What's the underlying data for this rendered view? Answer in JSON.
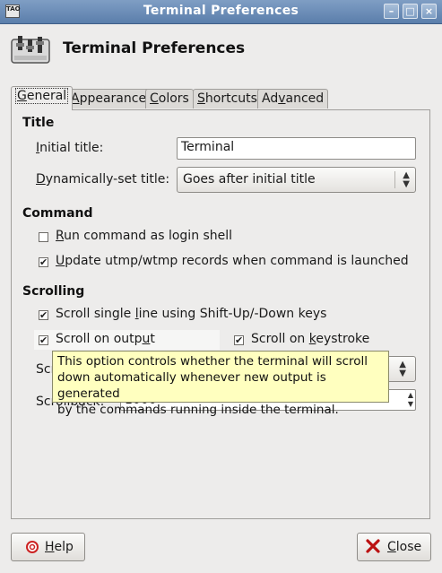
{
  "window": {
    "title": "Terminal Preferences",
    "icon_text": "TAO"
  },
  "header": {
    "title": "Terminal Preferences"
  },
  "tabs": [
    {
      "label": "General",
      "mn": "G",
      "rest": "eneral"
    },
    {
      "label": "Appearance",
      "mn": "A",
      "rest": "ppearance"
    },
    {
      "label": "Colors",
      "mn": "C",
      "rest": "olors"
    },
    {
      "label": "Shortcuts",
      "mn": "S",
      "rest": "hortcuts"
    },
    {
      "label": "Advanced",
      "pre": "Ad",
      "mn": "v",
      "rest": "anced"
    }
  ],
  "general": {
    "title_section": "Title",
    "initial_title_label": {
      "mn": "I",
      "rest": "nitial title:"
    },
    "initial_title_value": "Terminal",
    "dyn_title_label": {
      "mn": "D",
      "rest": "ynamically-set title:"
    },
    "dyn_title_value": "Goes after initial title",
    "command_section": "Command",
    "login_shell": {
      "mn": "R",
      "rest": "un command as login shell",
      "checked": false
    },
    "utmp": {
      "mn": "U",
      "rest": "pdate utmp/wtmp records when command is launched",
      "checked": true
    },
    "scrolling_section": "Scrolling",
    "single_line": {
      "pre": "Scroll single ",
      "mn": "l",
      "rest": "ine using Shift-Up/-Down keys",
      "checked": true
    },
    "scroll_output": {
      "pre": "Scroll on outp",
      "mn": "u",
      "rest": "t",
      "checked": true
    },
    "scroll_keystroke": {
      "pre": "Scroll on ",
      "mn": "k",
      "rest": "eystroke",
      "checked": true
    },
    "scrollbar_label_visible": "Scr",
    "scrollback_label_visible": "Scrollback:",
    "scrollback_value": "1000"
  },
  "tooltip": {
    "lines": [
      "This option controls whether the terminal will scroll",
      "down automatically whenever new output is generated",
      "by the commands running inside the terminal."
    ]
  },
  "buttons": {
    "help": {
      "mn": "H",
      "rest": "elp"
    },
    "close": {
      "mn": "C",
      "rest": "lose"
    }
  },
  "icons": {
    "check": "✔",
    "combo_arrows": "⌃⌄",
    "close_x": "✕"
  },
  "colors": {
    "titlebar": "#6a8cb8",
    "tooltip_bg": "#ffffbf"
  }
}
